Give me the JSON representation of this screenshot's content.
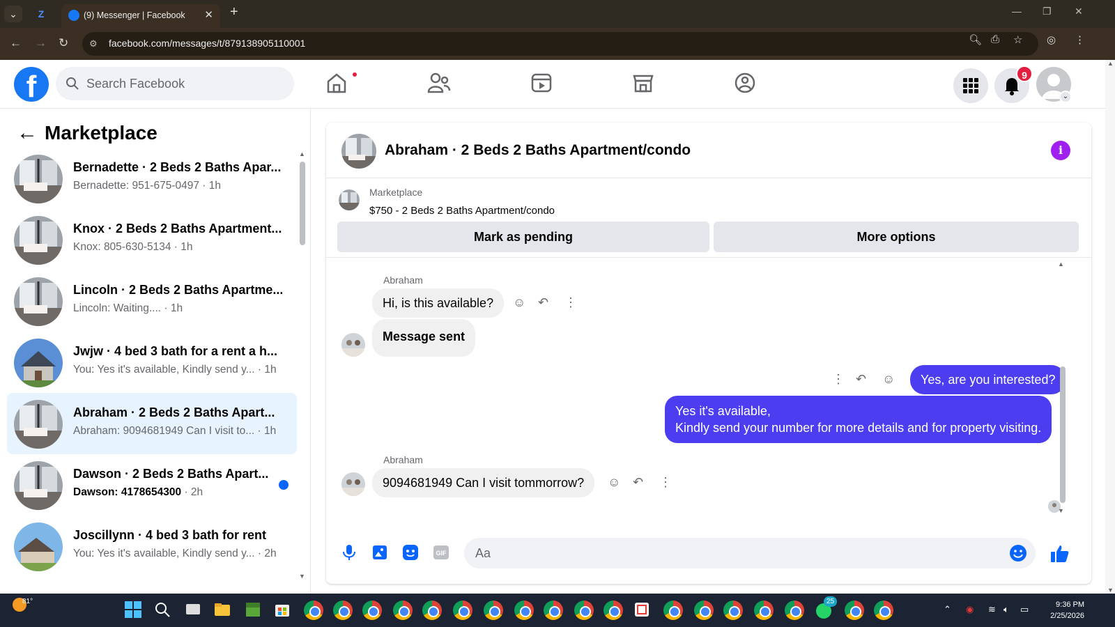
{
  "browser": {
    "tab_title": "(9) Messenger | Facebook",
    "url": "facebook.com/messages/t/879138905110001"
  },
  "header": {
    "search_placeholder": "Search Facebook",
    "notification_count": "9"
  },
  "sidebar": {
    "title": "Marketplace",
    "conversations": [
      {
        "name": "Bernadette · 2 Beds 2 Baths Apar...",
        "preview": "Bernadette: 951-675-0497",
        "time": "· 1h",
        "unread": false,
        "active": false
      },
      {
        "name": "Knox · 2 Beds 2 Baths Apartment...",
        "preview": "Knox: 805-630-5134",
        "time": "· 1h",
        "unread": false,
        "active": false
      },
      {
        "name": "Lincoln · 2 Beds 2 Baths Apartme...",
        "preview": "Lincoln: Waiting....",
        "time": "· 1h",
        "unread": false,
        "active": false
      },
      {
        "name": "Jwjw · 4 bed 3 bath for a rent a h...",
        "preview": "You: Yes it's available, Kindly send y...",
        "time": "· 1h",
        "unread": false,
        "active": false
      },
      {
        "name": "Abraham · 2 Beds 2 Baths Apart...",
        "preview": "Abraham: 9094681949 Can I visit to...",
        "time": "· 1h",
        "unread": false,
        "active": true
      },
      {
        "name": "Dawson · 2 Beds 2 Baths Apart...",
        "preview": "Dawson: 4178654300",
        "time": "· 2h",
        "unread": true,
        "active": false
      },
      {
        "name": "Joscillynn · 4 bed 3 bath for rent",
        "preview": "You: Yes it's available, Kindly send y...",
        "time": "· 2h",
        "unread": false,
        "active": false
      }
    ]
  },
  "chat": {
    "title": "Abraham · 2 Beds 2 Baths Apartment/condo",
    "marketplace_label": "Marketplace",
    "listing": "$750 - 2 Beds 2 Baths Apartment/condo",
    "mark_pending_label": "Mark as pending",
    "more_options_label": "More options",
    "messages": [
      {
        "sender": "Abraham",
        "text": "Hi, is this available?"
      },
      {
        "text": "Message sent"
      },
      {
        "text": "Yes, are you interested?"
      },
      {
        "text_line1": "Yes it's available,",
        "text_line2": "Kindly send your number for more details and for property visiting."
      },
      {
        "sender": "Abraham",
        "text": "9094681949 Can I visit tommorrow?"
      }
    ],
    "composer_placeholder": "Aa"
  },
  "taskbar": {
    "temperature": "81°",
    "time": "9:36 PM",
    "date": "2/25/2026",
    "whatsapp_badge": "25"
  },
  "colors": {
    "brand": "#1877f2",
    "outgoing_bubble": "#4c3df0",
    "active_conv": "#e7f3ff"
  }
}
